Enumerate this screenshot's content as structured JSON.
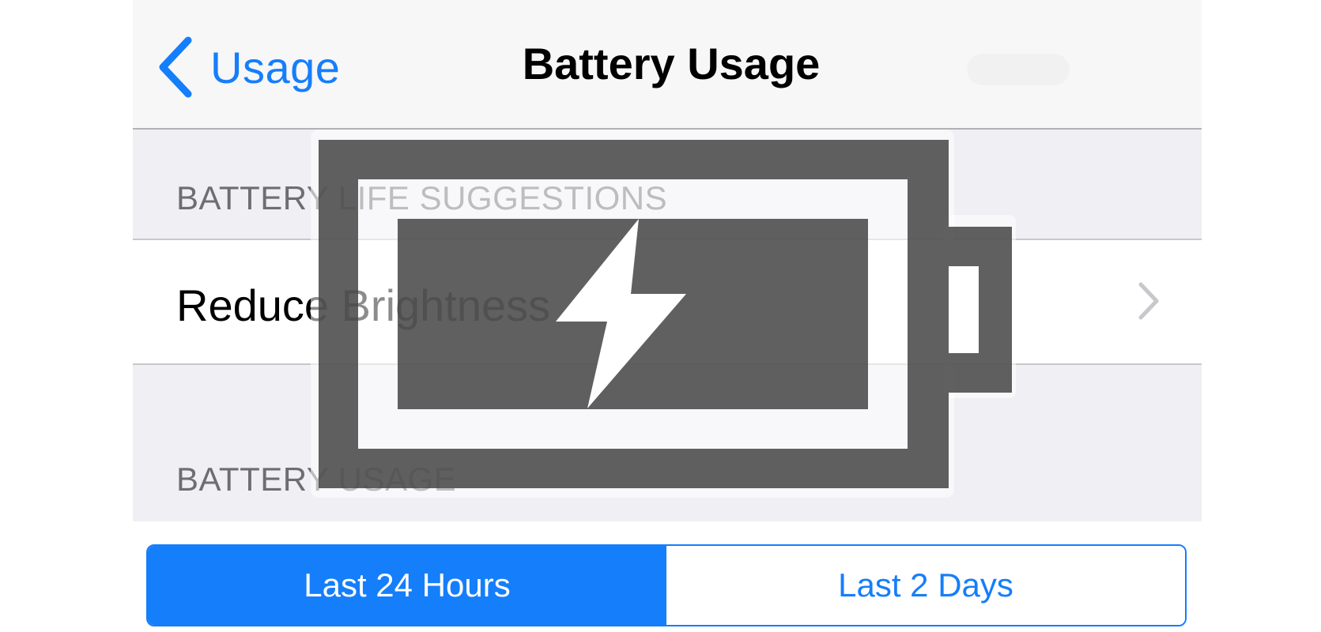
{
  "nav": {
    "back_label": "Usage",
    "title": "Battery Usage"
  },
  "sections": {
    "suggestions_header": "BATTERY LIFE SUGGESTIONS",
    "usage_header": "BATTERY USAGE"
  },
  "suggestion_cell": {
    "label": "Reduce Brightness"
  },
  "segmented_control": {
    "options": [
      "Last 24 Hours",
      "Last 2 Days"
    ],
    "selected": "Last 24 Hours"
  },
  "overlay": {
    "icon": "charging-battery-icon"
  },
  "colors": {
    "accent": "#157efb",
    "background": "#efeff4",
    "navbar": "#f7f7f7",
    "battery_icon": "#555555"
  }
}
